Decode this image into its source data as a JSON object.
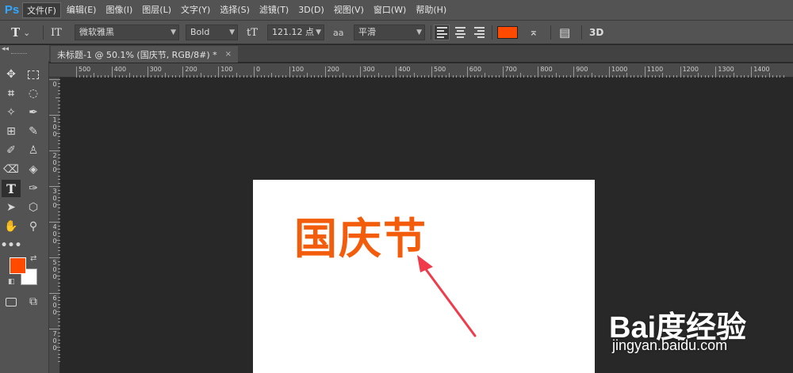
{
  "app": {
    "logo": "Ps",
    "menu": [
      "文件(F)",
      "编辑(E)",
      "图像(I)",
      "图层(L)",
      "文字(Y)",
      "选择(S)",
      "滤镜(T)",
      "3D(D)",
      "视图(V)",
      "窗口(W)",
      "帮助(H)"
    ],
    "active_menu": "文件(F)"
  },
  "options": {
    "tool_glyph": "T",
    "orientation_glyph": "IT",
    "font_family": "微软雅黑",
    "font_style": "Bold",
    "size_glyph": "tT",
    "font_size": "121.12 点",
    "aa_glyph": "aa",
    "antialias": "平滑",
    "text_color": "#ff4a00",
    "warp_glyph": "⌅",
    "panel_glyph": "▤",
    "mode_3d": "3D"
  },
  "document": {
    "tab_title": "未标题-1 @ 50.1% (国庆节, RGB/8#) *",
    "close_label": "×",
    "headline": "国庆节",
    "headline_color": "#f25c0a"
  },
  "ruler_top": [
    "500",
    "400",
    "300",
    "200",
    "100",
    "0",
    "100",
    "200",
    "300",
    "400",
    "500",
    "600",
    "700",
    "800",
    "900",
    "1000",
    "1100",
    "1200",
    "1300",
    "1400"
  ],
  "ruler_left": [
    "0",
    "100",
    "200",
    "300",
    "400",
    "500",
    "600",
    "700"
  ],
  "tools": {
    "foreground_color": "#ff4a00",
    "background_color": "#ffffff"
  },
  "watermark": {
    "main": "Bai度经验",
    "url": "jingyan.baidu.com"
  },
  "colors": {
    "arrow": "#ef3b4a",
    "accent": "#31a8ff"
  }
}
